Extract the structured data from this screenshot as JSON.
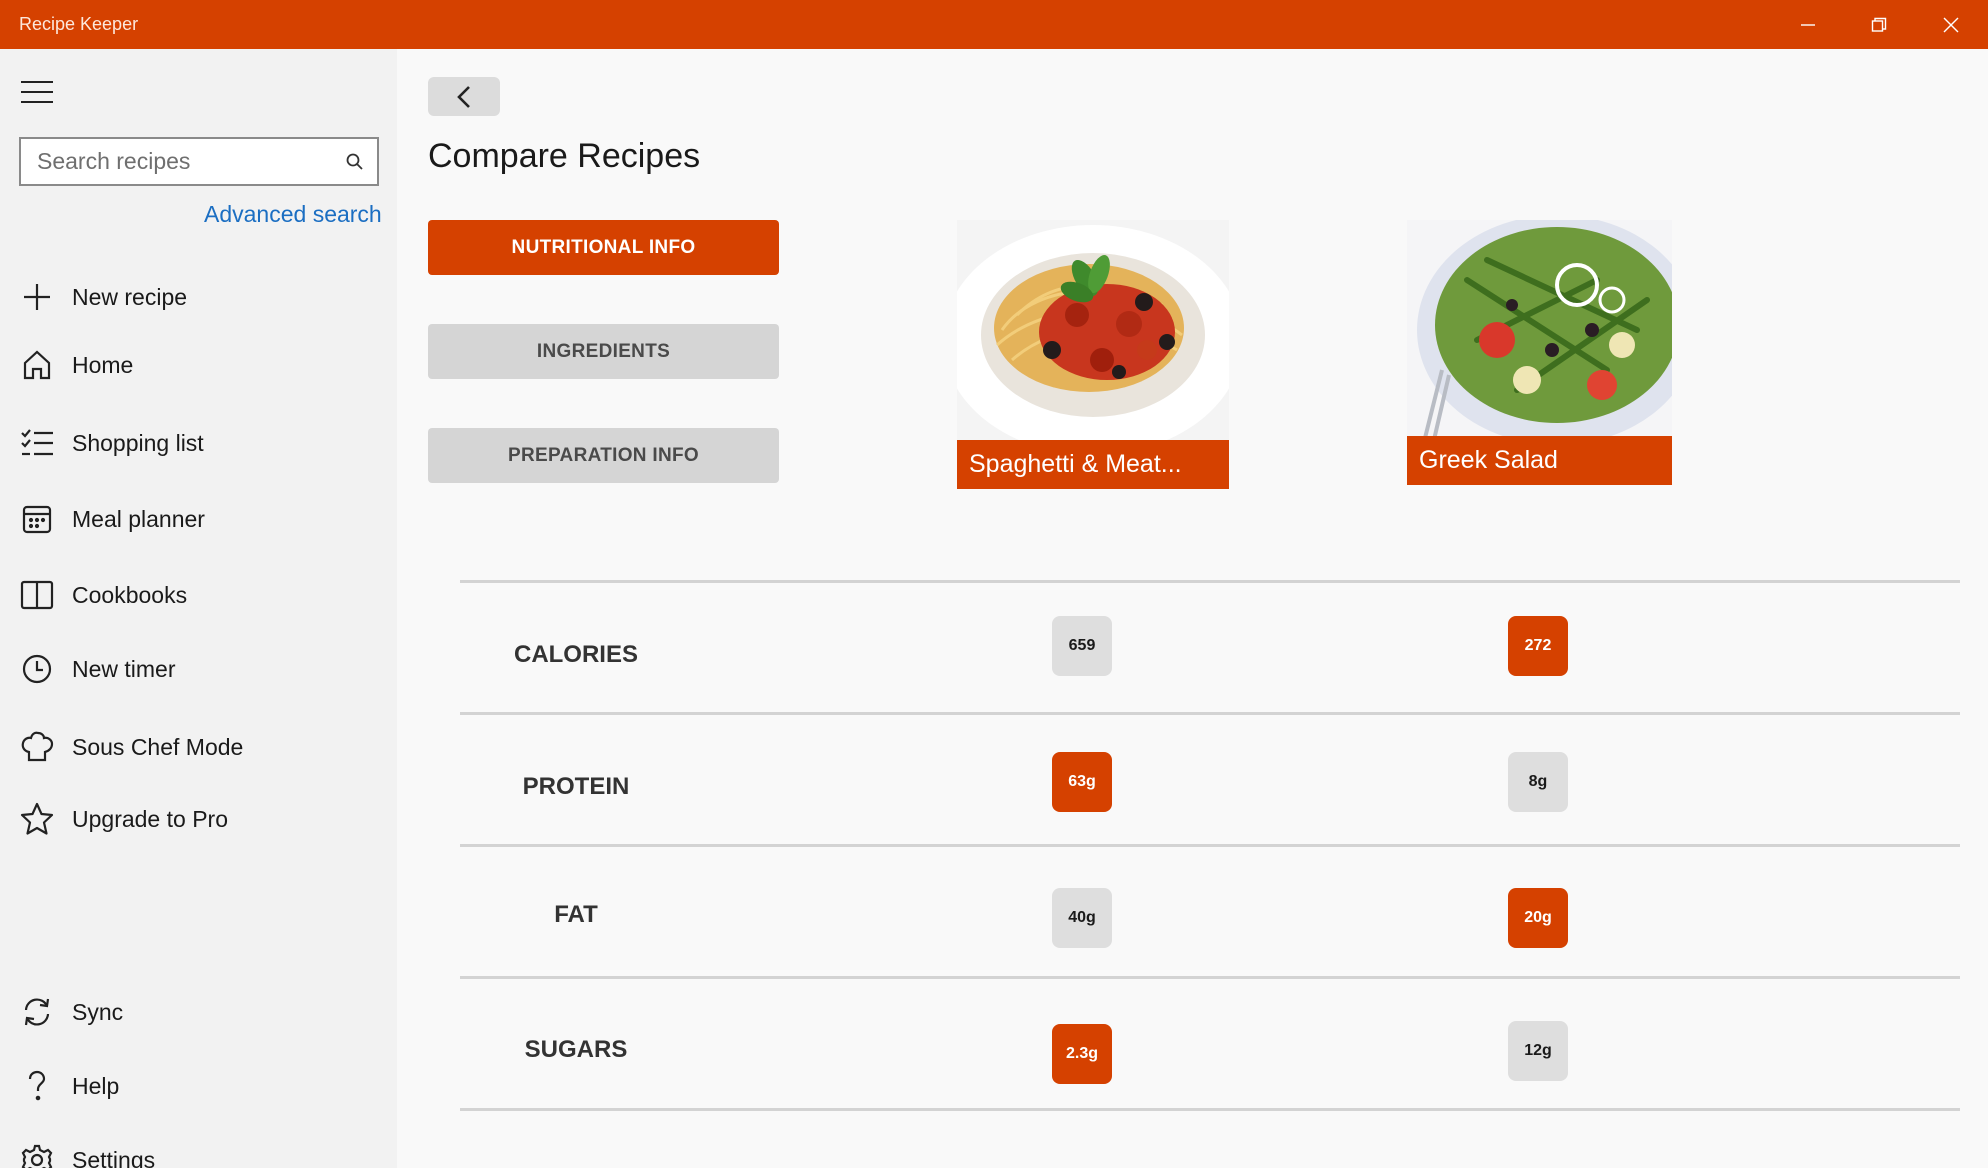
{
  "window": {
    "title": "Recipe Keeper",
    "controls": [
      "minimize-icon",
      "restore-icon",
      "close-icon"
    ],
    "accent_color": "#d54100"
  },
  "sidebar": {
    "search": {
      "placeholder": "Search recipes",
      "value": ""
    },
    "advanced_search": "Advanced search",
    "items": [
      {
        "label": "New recipe",
        "icon": "plus-icon"
      },
      {
        "label": "Home",
        "icon": "home-icon"
      },
      {
        "label": "Shopping list",
        "icon": "checklist-icon"
      },
      {
        "label": "Meal planner",
        "icon": "calendar-icon"
      },
      {
        "label": "Cookbooks",
        "icon": "book-icon"
      },
      {
        "label": "New timer",
        "icon": "clock-icon"
      },
      {
        "label": "Sous Chef Mode",
        "icon": "chef-hat-icon"
      },
      {
        "label": "Upgrade to Pro",
        "icon": "star-icon"
      }
    ],
    "footer_items": [
      {
        "label": "Sync",
        "icon": "sync-icon"
      },
      {
        "label": "Help",
        "icon": "help-icon"
      },
      {
        "label": "Settings",
        "icon": "gear-icon"
      }
    ]
  },
  "main": {
    "title": "Compare Recipes",
    "tabs": [
      {
        "label": "NUTRITIONAL INFO",
        "active": true
      },
      {
        "label": "INGREDIENTS",
        "active": false
      },
      {
        "label": "PREPARATION INFO",
        "active": false
      }
    ],
    "recipes": [
      {
        "name": "Spaghetti & Meat...",
        "image": "spaghetti-photo"
      },
      {
        "name": "Greek Salad",
        "image": "salad-photo"
      }
    ],
    "nutrition": [
      {
        "label": "CALORIES",
        "values": [
          "659",
          "272"
        ],
        "highlight": [
          false,
          true
        ]
      },
      {
        "label": "PROTEIN",
        "values": [
          "63g",
          "8g"
        ],
        "highlight": [
          true,
          false
        ]
      },
      {
        "label": "FAT",
        "values": [
          "40g",
          "20g"
        ],
        "highlight": [
          false,
          true
        ]
      },
      {
        "label": "SUGARS",
        "values": [
          "2.3g",
          "12g"
        ],
        "highlight": [
          true,
          false
        ]
      }
    ]
  }
}
